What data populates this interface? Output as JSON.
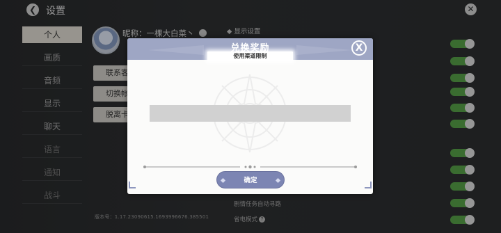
{
  "header": {
    "back_icon": "back-arrow-icon",
    "title": "设置",
    "close_icon": "close-icon"
  },
  "sidebar": {
    "items": [
      {
        "label": "个人",
        "active": true
      },
      {
        "label": "画质",
        "active": false
      },
      {
        "label": "音频",
        "active": false
      },
      {
        "label": "显示",
        "active": false
      },
      {
        "label": "聊天",
        "active": false
      },
      {
        "label": "语言",
        "active": false
      },
      {
        "label": "通知",
        "active": false
      },
      {
        "label": "战斗",
        "active": false
      }
    ]
  },
  "profile": {
    "nickname": "昵称：一棵大白菜丶",
    "edit_icon": "edit-pencil-icon"
  },
  "profile_buttons": {
    "contact": "联系客",
    "switch": "切换帐",
    "leave": "脱离卡"
  },
  "version": "版本号：1.17.23090615.1693996676.385501",
  "settings": {
    "section_title": "◆ 显示设置",
    "row_auto_task": "剧情任务自动寻路",
    "row_power_mode": "省电模式",
    "help_glyph": "?"
  },
  "modal": {
    "title": "兑换奖励",
    "subtitle": "使用渠道限制",
    "close_glyph": "X",
    "input_value": "",
    "confirm_label": "确定"
  },
  "colors": {
    "modal_header": "#9ea6c4",
    "confirm_button": "#7c85b3",
    "toggle_on": "#5aa64a",
    "sidebar_active": "#e8e4da"
  }
}
